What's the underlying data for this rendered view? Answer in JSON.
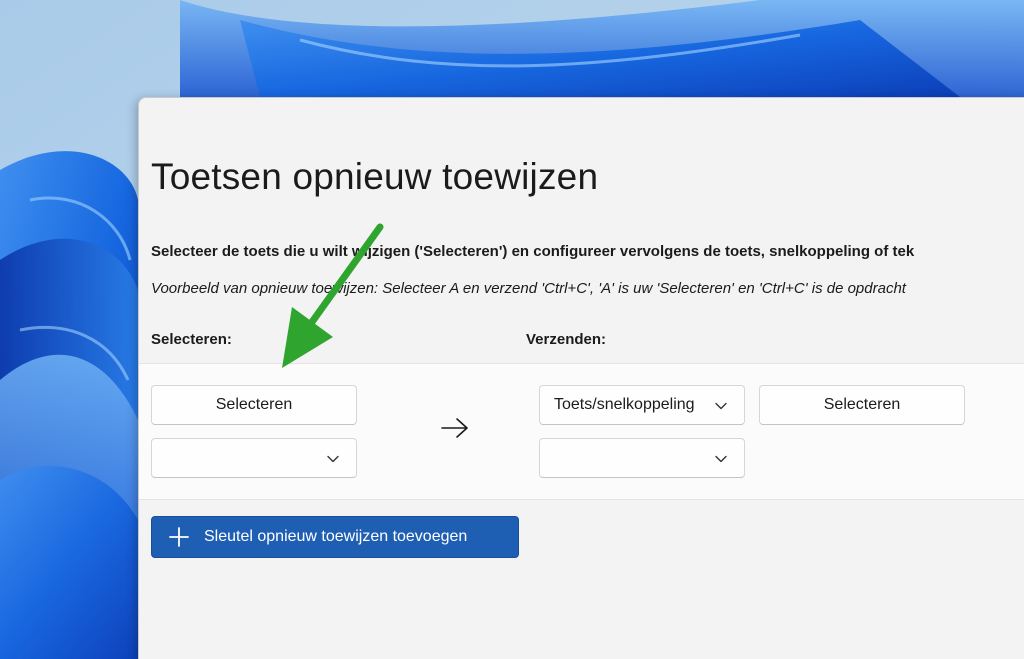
{
  "colors": {
    "accent": "#1e5fb4",
    "annotation_arrow": "#2fa52f",
    "dialog_background": "#f3f3f3"
  },
  "dialog": {
    "title": "Toetsen opnieuw toewijzen",
    "description": "Selecteer de toets die u wilt wijzigen ('Selecteren') en configureer vervolgens de toets, snelkoppeling of tek",
    "example": "Voorbeeld van opnieuw toewijzen: Selecteer A en verzend 'Ctrl+C', 'A' is uw 'Selecteren' en 'Ctrl+C' is de opdracht",
    "select_label": "Selecteren:",
    "send_label": "Verzenden:",
    "select_button": "Selecteren",
    "select_key_dropdown_value": "",
    "mapping_arrow_icon": "arrow-right-icon",
    "send_type_dropdown_value": "Toets/snelkoppeling",
    "send_select_button": "Selecteren",
    "send_key_dropdown_value": "",
    "add_button": "Sleutel opnieuw toewijzen toevoegen",
    "add_button_icon": "plus-icon"
  },
  "annotation": {
    "icon": "green-arrow-icon"
  }
}
